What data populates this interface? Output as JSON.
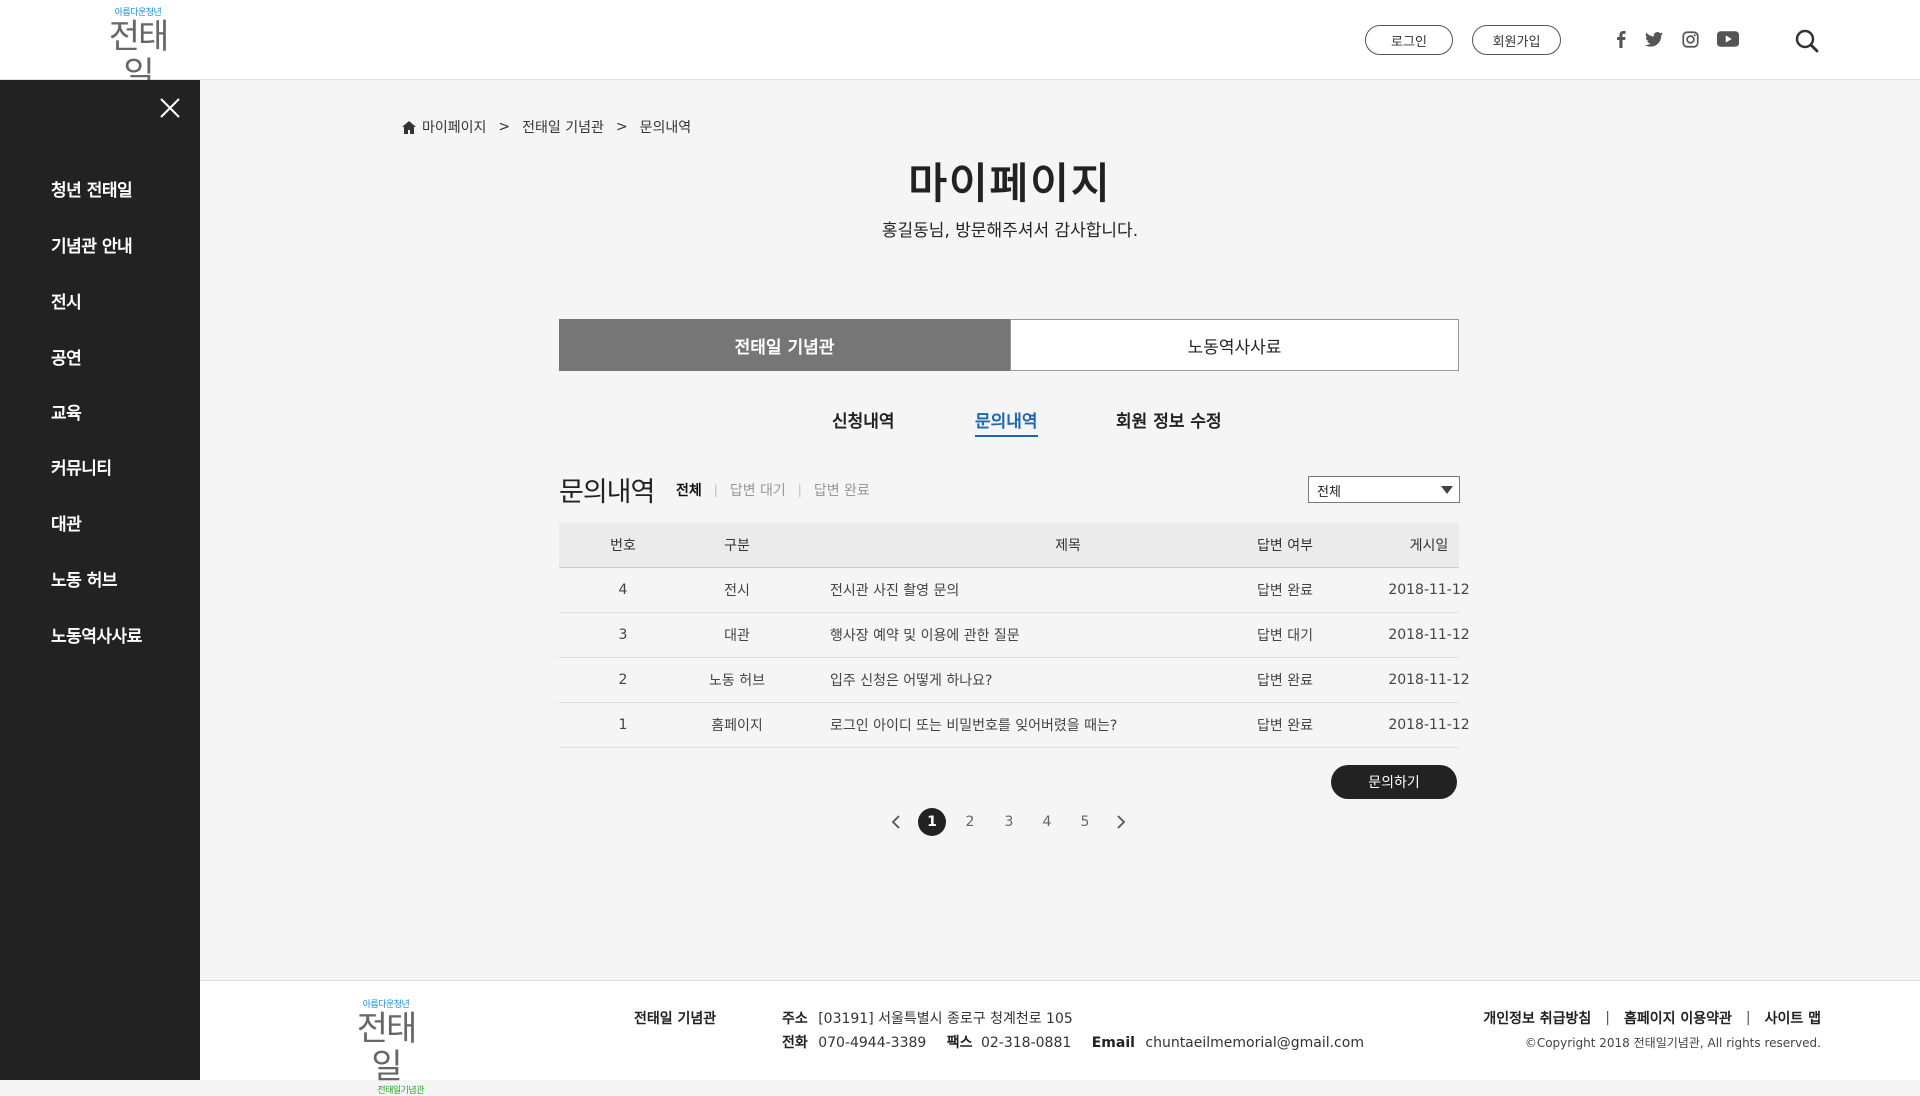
{
  "header": {
    "logo": {
      "line1": "아름다운청년",
      "line2": "전태일",
      "line3": "전태일기념관"
    },
    "login_label": "로그인",
    "signup_label": "회원가입",
    "social": [
      "facebook-icon",
      "twitter-icon",
      "instagram-icon",
      "youtube-icon"
    ]
  },
  "sidebar": {
    "items": [
      {
        "label": "청년 전태일"
      },
      {
        "label": "기념관 안내"
      },
      {
        "label": "전시"
      },
      {
        "label": "공연"
      },
      {
        "label": "교육"
      },
      {
        "label": "커뮤니티"
      },
      {
        "label": "대관"
      },
      {
        "label": "노동 허브"
      },
      {
        "label": "노동역사사료"
      }
    ]
  },
  "breadcrumb": [
    "마이페이지",
    "전태일 기념관",
    "문의내역"
  ],
  "breadcrumb_sep": ">",
  "page": {
    "title": "마이페이지",
    "subtitle": "홍길동님, 방문해주셔서 감사합니다."
  },
  "tabs": [
    {
      "label": "전태일 기념관",
      "active": true
    },
    {
      "label": "노동역사사료",
      "active": false
    }
  ],
  "subnav": [
    {
      "label": "신청내역",
      "active": false
    },
    {
      "label": "문의내역",
      "active": true
    },
    {
      "label": "회원 정보 수정",
      "active": false
    }
  ],
  "section": {
    "title": "문의내역",
    "filters": [
      {
        "label": "전체",
        "active": true
      },
      {
        "label": "답변 대기",
        "active": false
      },
      {
        "label": "답변 완료",
        "active": false
      }
    ],
    "filter_sep": "|",
    "select_value": "전체"
  },
  "table": {
    "headers": {
      "no": "번호",
      "category": "구분",
      "title": "제목",
      "answer": "답변 여부",
      "date": "게시일"
    },
    "rows": [
      {
        "no": "4",
        "category": "전시",
        "title": "전시관 사진 촬영 문의",
        "answer": "답변 완료",
        "date": "2018-11-12"
      },
      {
        "no": "3",
        "category": "대관",
        "title": "행사장 예약 및 이용에 관한 질문",
        "answer": "답변 대기",
        "date": "2018-11-12"
      },
      {
        "no": "2",
        "category": "노동 허브",
        "title": "입주 신청은 어떻게 하나요?",
        "answer": "답변 완료",
        "date": "2018-11-12"
      },
      {
        "no": "1",
        "category": "홈페이지",
        "title": "로그인 아이디 또는 비밀번호를 잊어버렸을 때는?",
        "answer": "답변 완료",
        "date": "2018-11-12"
      }
    ]
  },
  "ask_button": "문의하기",
  "pagination": {
    "pages": [
      "1",
      "2",
      "3",
      "4",
      "5"
    ],
    "current": "1"
  },
  "footer": {
    "org": "전태일 기념관",
    "address_label": "주소",
    "address": "[03191] 서울특별시 종로구 청계천로 105",
    "tel_label": "전화",
    "tel": "070-4944-3389",
    "fax_label": "팩스",
    "fax": "02-318-0881",
    "email_label": "Email",
    "email": "chuntaeilmemorial@gmail.com",
    "links": [
      "개인정보 취급방침",
      "홈페이지 이용약관",
      "사이트 맵"
    ],
    "link_sep": "|",
    "copyright": "©Copyright 2018 전태일기념관, All rights reserved."
  }
}
